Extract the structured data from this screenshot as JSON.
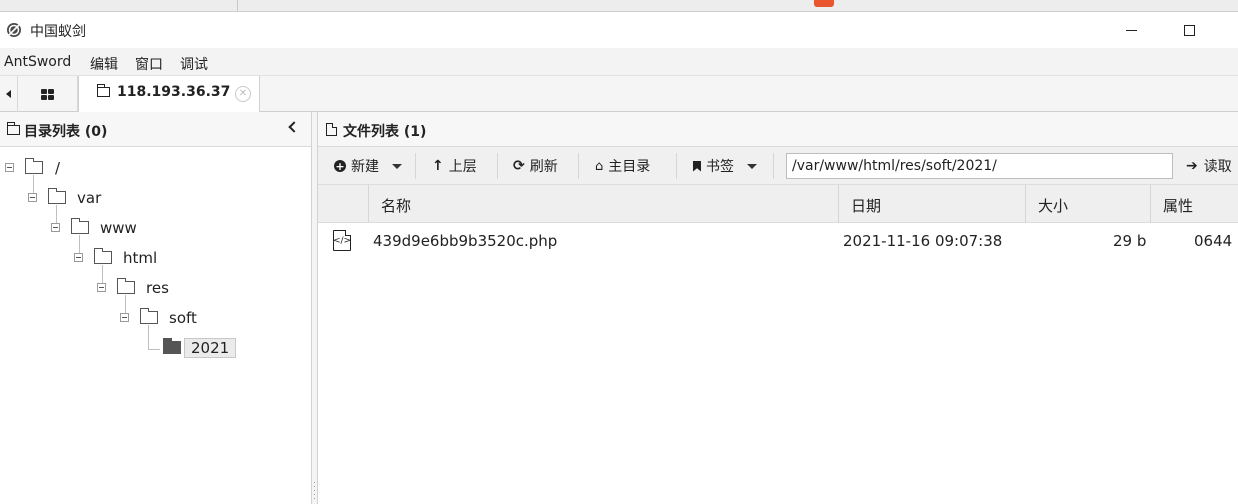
{
  "window": {
    "title": "中国蚁剑",
    "controls": [
      "minimize",
      "maximize"
    ]
  },
  "menu": {
    "items": [
      "AntSword",
      "编辑",
      "窗口",
      "调试"
    ]
  },
  "tabs": {
    "active_label": "118.193.36.37",
    "close_glyph": "✕"
  },
  "dir_panel": {
    "title": "目录列表 (0)",
    "tree": [
      {
        "name": "/",
        "depth": 0
      },
      {
        "name": "var",
        "depth": 1
      },
      {
        "name": "www",
        "depth": 2
      },
      {
        "name": "html",
        "depth": 3
      },
      {
        "name": "res",
        "depth": 4
      },
      {
        "name": "soft",
        "depth": 5
      },
      {
        "name": "2021",
        "depth": 6,
        "selected": true
      }
    ]
  },
  "file_panel": {
    "title": "文件列表 (1)",
    "toolbar": {
      "new_label": "新建",
      "up_label": "上层",
      "refresh_label": "刷新",
      "home_label": "主目录",
      "bookmark_label": "书签",
      "path_value": "/var/www/html/res/soft/2021/",
      "read_label": "读取"
    },
    "columns": [
      "名称",
      "日期",
      "大小",
      "属性"
    ],
    "files": [
      {
        "name": "439d9e6bb9b3520c.php",
        "date": "2021-11-16 09:07:38",
        "size": "29 b",
        "attr": "0644"
      }
    ]
  },
  "icons": {
    "app": "antsword-logo-icon",
    "file": "php-file-icon"
  }
}
